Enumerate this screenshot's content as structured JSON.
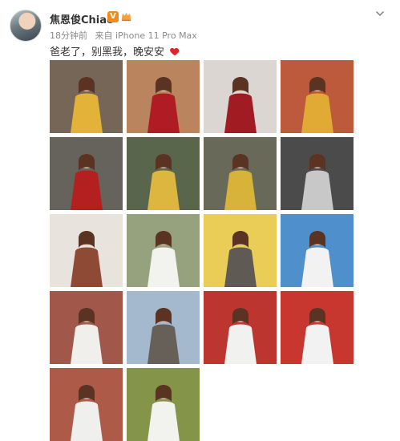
{
  "user": {
    "name": "焦恩俊Chiao",
    "verified_badge": "V",
    "post_time": "18分钟前",
    "source": "来自 iPhone 11 Pro Max"
  },
  "post": {
    "text": "爸老了，别黑我，晚安安"
  },
  "photos": [
    {
      "name": "photo-yellow-sweater-brick-wall",
      "bg": "#6b5a4a",
      "accent": "#e2b239"
    },
    {
      "name": "photo-red-dress-doorway",
      "bg": "#b57a52",
      "accent": "#b01c24"
    },
    {
      "name": "photo-red-dress-steps",
      "bg": "#d9d3cf",
      "accent": "#a01b22"
    },
    {
      "name": "photo-yellow-sweater-portrait",
      "bg": "#b94d2c",
      "accent": "#e0aa35"
    },
    {
      "name": "photo-red-dress-trees",
      "bg": "#5a554f",
      "accent": "#b3201f"
    },
    {
      "name": "photo-yellow-sweater-tree",
      "bg": "#4b5a3d",
      "accent": "#ddb63f"
    },
    {
      "name": "photo-yellow-sweater-forest",
      "bg": "#5d5d4b",
      "accent": "#d8b339"
    },
    {
      "name": "photo-black-and-white-forest",
      "bg": "#3c3c3c",
      "accent": "#c8c8c8"
    },
    {
      "name": "photo-white-dress-close-up",
      "bg": "#e7e1d9",
      "accent": "#8e4a35"
    },
    {
      "name": "photo-white-dress-sitting-grass",
      "bg": "#8e9a73",
      "accent": "#f2f2ee"
    },
    {
      "name": "photo-grey-dress-yellow-wall",
      "bg": "#e8c949",
      "accent": "#5f5a53"
    },
    {
      "name": "photo-white-dress-blue-sky",
      "bg": "#3f86c8",
      "accent": "#f2f2f2"
    },
    {
      "name": "photo-white-dress-arch",
      "bg": "#9a4a3c",
      "accent": "#f0efeb"
    },
    {
      "name": "photo-grey-dress-lavender",
      "bg": "#9db3c9",
      "accent": "#676059"
    },
    {
      "name": "photo-white-dress-red-wall",
      "bg": "#b7251e",
      "accent": "#f1f1ef"
    },
    {
      "name": "photo-white-dress-red-pavilion",
      "bg": "#c3251e",
      "accent": "#f2f2f2"
    },
    {
      "name": "photo-white-dress-arch-path",
      "bg": "#a84d3a",
      "accent": "#efefed"
    },
    {
      "name": "photo-white-dress-garden",
      "bg": "#7a8b3a",
      "accent": "#f2f2ee"
    }
  ],
  "colors": {
    "heart": "#e0242e",
    "meta_gray": "#8a8a8a"
  }
}
